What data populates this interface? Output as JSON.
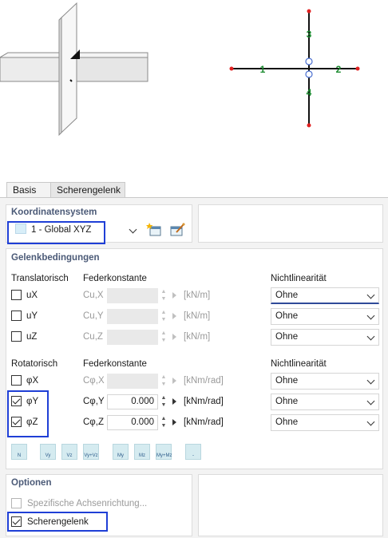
{
  "diagram": {
    "node_labels": [
      "1",
      "2",
      "3",
      "4"
    ]
  },
  "tabs": [
    {
      "label": "Basis",
      "active": true
    },
    {
      "label": "Scherengelenk",
      "active": false
    }
  ],
  "koordinatensystem": {
    "title": "Koordinatensystem",
    "selected": "1 - Global XYZ"
  },
  "gelenk": {
    "title": "Gelenkbedingungen",
    "translation": {
      "heading": "Translatorisch",
      "spring_heading": "Federkonstante",
      "nonlin_heading": "Nichtlinearität",
      "rows": [
        {
          "dof": "uX",
          "checked": false,
          "spring": "Cu,X",
          "value": "",
          "unit": "[kN/m]",
          "nonlin": "Ohne"
        },
        {
          "dof": "uY",
          "checked": false,
          "spring": "Cu,Y",
          "value": "",
          "unit": "[kN/m]",
          "nonlin": "Ohne"
        },
        {
          "dof": "uZ",
          "checked": false,
          "spring": "Cu,Z",
          "value": "",
          "unit": "[kN/m]",
          "nonlin": "Ohne"
        }
      ]
    },
    "rotation": {
      "heading": "Rotatorisch",
      "spring_heading": "Federkonstante",
      "nonlin_heading": "Nichtlinearität",
      "rows": [
        {
          "dof": "φX",
          "checked": false,
          "spring": "Cφ,X",
          "value": "",
          "unit": "[kNm/rad]",
          "nonlin": "Ohne"
        },
        {
          "dof": "φY",
          "checked": true,
          "spring": "Cφ,Y",
          "value": "0.000",
          "unit": "[kNm/rad]",
          "nonlin": "Ohne"
        },
        {
          "dof": "φZ",
          "checked": true,
          "spring": "Cφ,Z",
          "value": "0.000",
          "unit": "[kNm/rad]",
          "nonlin": "Ohne"
        }
      ]
    },
    "symbol_buttons": [
      "N",
      "Vy",
      "Vz",
      "Vy+Vz",
      "My",
      "Mz",
      "My+Mz",
      "-"
    ]
  },
  "optionen": {
    "title": "Optionen",
    "specific_axes": "Spezifische Achsenrichtung...",
    "specific_axes_checked": false,
    "scherengelenk": "Scherengelenk",
    "scherengelenk_checked": true
  },
  "colors": {
    "highlight": "#1f3fd6",
    "node_green": "#1a8a2e",
    "node_red": "#e02020",
    "section_title": "#4b5a77"
  }
}
